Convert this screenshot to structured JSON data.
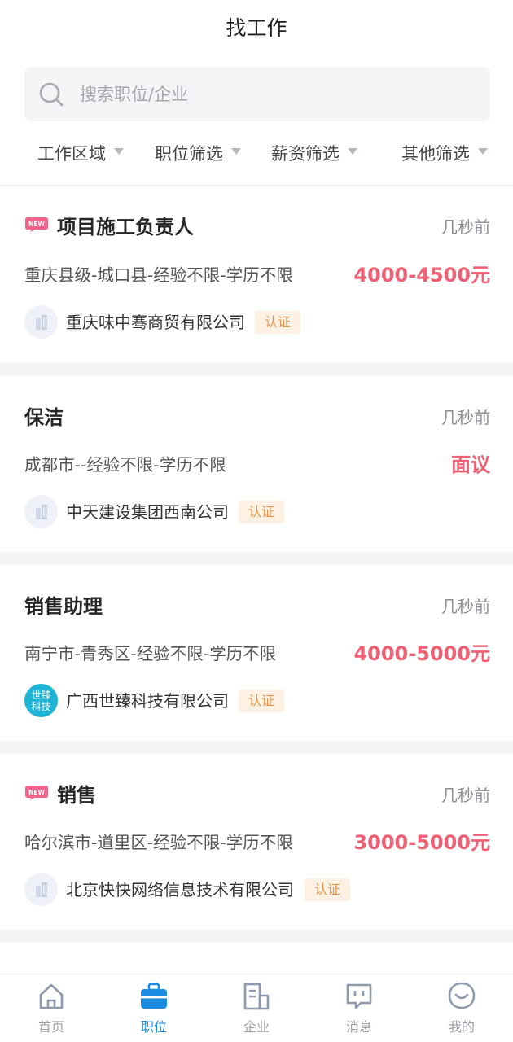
{
  "header": {
    "title": "找工作",
    "search_placeholder": "搜索职位/企业",
    "filters": [
      "工作区域",
      "职位筛选",
      "薪资筛选",
      "其他筛选"
    ]
  },
  "jobs": [
    {
      "is_new": true,
      "title": "项目施工负责人",
      "time": "几秒前",
      "location": "重庆县级-城口县-经验不限-学历不限",
      "salary": "4000-4500元",
      "company": "重庆味中骞商贸有限公司",
      "verified": "认证",
      "logo": "building-icon"
    },
    {
      "is_new": false,
      "title": "保洁",
      "time": "几秒前",
      "location": "成都市--经验不限-学历不限",
      "salary": "面议",
      "company": "中天建设集团西南公司",
      "verified": "认证",
      "logo": "building-icon"
    },
    {
      "is_new": false,
      "title": "销售助理",
      "time": "几秒前",
      "location": "南宁市-青秀区-经验不限-学历不限",
      "salary": "4000-5000元",
      "company": "广西世臻科技有限公司",
      "verified": "认证",
      "logo": "brand-logo",
      "logo_text": [
        "世臻",
        "科技"
      ]
    },
    {
      "is_new": true,
      "title": "销售",
      "time": "几秒前",
      "location": "哈尔滨市-道里区-经验不限-学历不限",
      "salary": "3000-5000元",
      "company": "北京快快网络信息技术有限公司",
      "verified": "认证",
      "logo": "building-icon"
    }
  ],
  "badge": {
    "new_label": "NEW"
  },
  "tabbar": {
    "active_index": 1,
    "tabs": [
      {
        "label": "首页",
        "icon": "home-icon"
      },
      {
        "label": "职位",
        "icon": "briefcase-icon"
      },
      {
        "label": "企业",
        "icon": "company-building-icon"
      },
      {
        "label": "消息",
        "icon": "message-icon"
      },
      {
        "label": "我的",
        "icon": "profile-icon"
      }
    ]
  },
  "colors": {
    "salary": "#ef5f73",
    "active_tab": "#1a8de3",
    "verify_text": "#e1944a",
    "verify_bg": "#fdf1e3",
    "new_badge": "#f0648c"
  }
}
